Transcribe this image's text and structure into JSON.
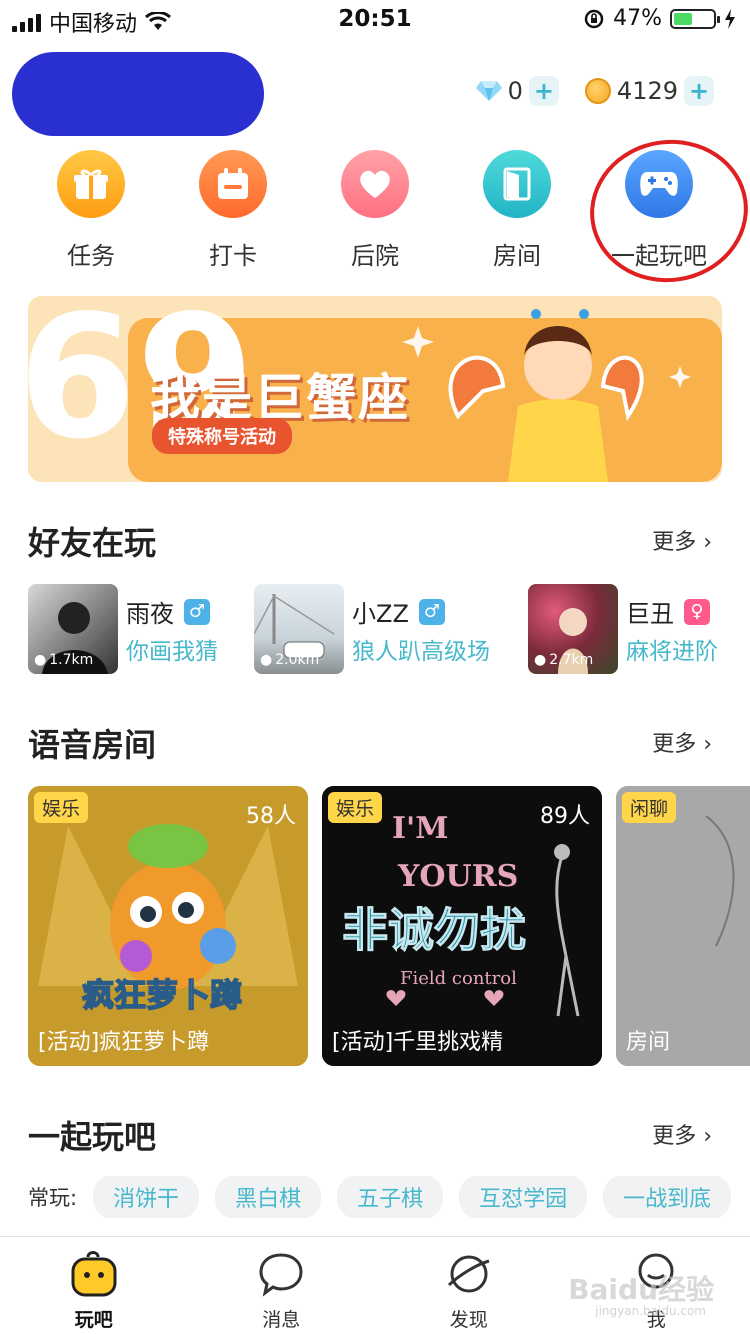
{
  "status_bar": {
    "carrier": "中国移动",
    "time": "20:51",
    "battery": "47%",
    "battery_level": 0.47
  },
  "header": {
    "diamonds": "0",
    "coins": "4129",
    "plus": "+"
  },
  "quick_actions": [
    {
      "label": "任务",
      "icon": "gift-icon",
      "color": "#ffb020"
    },
    {
      "label": "打卡",
      "icon": "calendar-icon",
      "color": "#ff7a3c"
    },
    {
      "label": "后院",
      "icon": "heart-icon",
      "color": "#ff7b8c"
    },
    {
      "label": "房间",
      "icon": "door-icon",
      "color": "#37c7d0"
    },
    {
      "label": "一起玩吧",
      "icon": "gamepad-icon",
      "color": "#3c8cf0"
    }
  ],
  "banner": {
    "title": "我是巨蟹座",
    "subtitle": "特殊称号活动"
  },
  "friends_section": {
    "title": "好友在玩",
    "more": "更多",
    "friends": [
      {
        "name": "雨夜",
        "gender": "♂",
        "game": "你画我猜",
        "distance": "1.7km"
      },
      {
        "name": "小ZZ",
        "gender": "♂",
        "game": "狼人趴高级场",
        "distance": "2.0km"
      },
      {
        "name": "巨丑",
        "gender": "♀",
        "game": "麻将进阶",
        "distance": "2.7km"
      }
    ]
  },
  "rooms_section": {
    "title": "语音房间",
    "more": "更多",
    "rooms": [
      {
        "tag": "娱乐",
        "count": "58人",
        "name": "[活动]疯狂萝卜蹲",
        "art_text": "疯狂萝卜蹲"
      },
      {
        "tag": "娱乐",
        "count": "89人",
        "name": "[活动]千里挑戏精",
        "art_text": "非诚勿扰",
        "art_line1": "I'M",
        "art_line2": "YOURS",
        "art_line3": "Field control"
      },
      {
        "tag": "闲聊",
        "count": "",
        "name": "房间"
      }
    ]
  },
  "play_section": {
    "title": "一起玩吧",
    "more": "更多",
    "label": "常玩:",
    "games": [
      "消饼干",
      "黑白棋",
      "五子棋",
      "互怼学园",
      "一战到底"
    ]
  },
  "tabbar": {
    "tabs": [
      {
        "label": "玩吧",
        "icon": "wanba-icon"
      },
      {
        "label": "消息",
        "icon": "chat-bubble-icon"
      },
      {
        "label": "发现",
        "icon": "planet-icon"
      },
      {
        "label": "我",
        "icon": "profile-icon"
      }
    ],
    "active": "玩吧"
  },
  "watermark": {
    "text": "Baidu经验",
    "sub": "jingyan.baidu.com"
  }
}
